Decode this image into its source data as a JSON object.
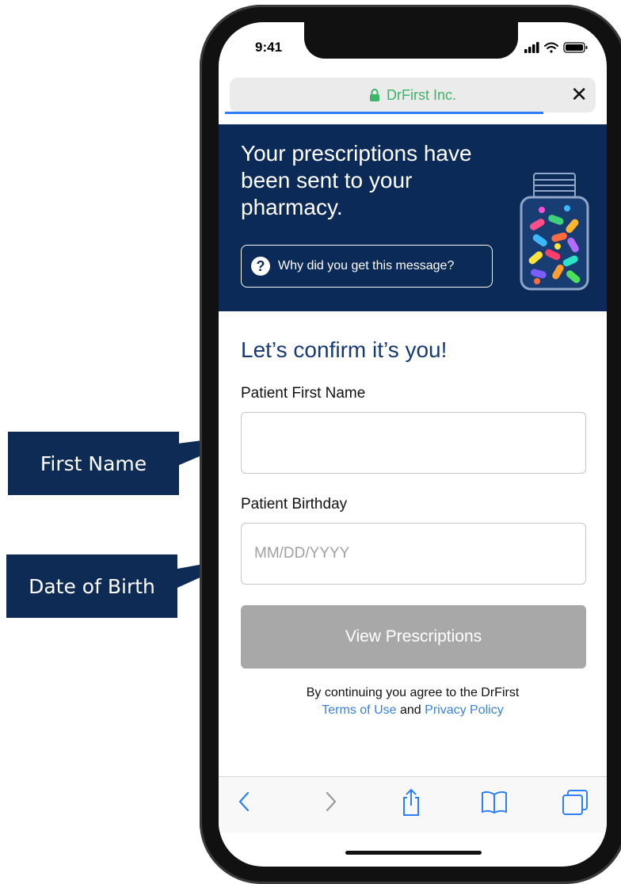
{
  "callouts": {
    "first_name": "First Name",
    "date_of_birth": "Date of Birth"
  },
  "status_bar": {
    "time": "9:41"
  },
  "browser": {
    "url_text": "DrFirst Inc.",
    "close_symbol": "✕"
  },
  "hero": {
    "title": "Your prescriptions have been sent to your pharmacy.",
    "why_button_label": "Why did you get this message?",
    "why_icon_glyph": "?"
  },
  "form": {
    "heading": "Let’s confirm it’s you!",
    "first_name_label": "Patient First Name",
    "first_name_value": "",
    "birthday_label": "Patient Birthday",
    "birthday_placeholder": "MM/DD/YYYY",
    "submit_label": "View Prescriptions"
  },
  "legal": {
    "prefix": "By continuing you agree to the DrFirst",
    "terms": "Terms of Use",
    "and": "and",
    "privacy": "Privacy Policy"
  },
  "colors": {
    "brand_navy": "#0b2a57",
    "link_blue": "#3a83d8",
    "secure_green": "#3cb46a",
    "disabled_button": "#a8a8a8"
  },
  "icons": [
    "lock-icon",
    "close-icon",
    "question-icon",
    "pill-bottle-icon",
    "back-icon",
    "forward-icon",
    "share-icon",
    "bookmarks-icon",
    "tabs-icon"
  ]
}
